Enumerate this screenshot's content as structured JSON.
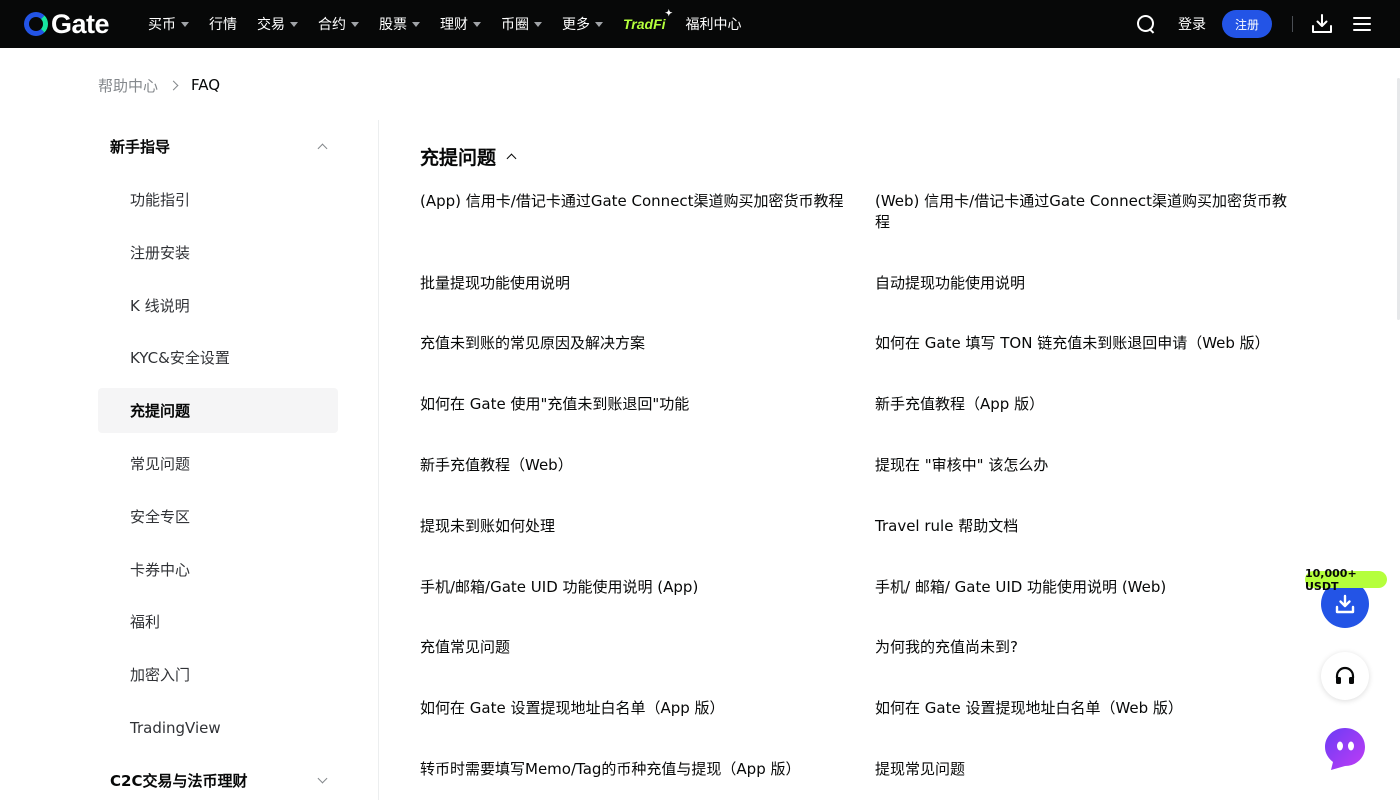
{
  "header": {
    "logo_text": "Gate",
    "nav": [
      {
        "label": "买币",
        "dropdown": true
      },
      {
        "label": "行情",
        "dropdown": false
      },
      {
        "label": "交易",
        "dropdown": true
      },
      {
        "label": "合约",
        "dropdown": true
      },
      {
        "label": "股票",
        "dropdown": true
      },
      {
        "label": "理财",
        "dropdown": true
      },
      {
        "label": "币圈",
        "dropdown": true
      },
      {
        "label": "更多",
        "dropdown": true
      }
    ],
    "tradfi_label": "TradFi",
    "welfare_label": "福利中心",
    "login_label": "登录",
    "signup_label": "注册",
    "search_icon": "search-icon",
    "download_icon": "download-icon",
    "menu_icon": "menu-icon"
  },
  "breadcrumb": {
    "home": "帮助中心",
    "current": "FAQ"
  },
  "sidebar": {
    "group_top": "新手指导",
    "items": [
      {
        "label": "功能指引",
        "active": false
      },
      {
        "label": "注册安装",
        "active": false
      },
      {
        "label": "K 线说明",
        "active": false
      },
      {
        "label": "KYC&安全设置",
        "active": false
      },
      {
        "label": "充提问题",
        "active": true
      },
      {
        "label": "常见问题",
        "active": false
      },
      {
        "label": "安全专区",
        "active": false
      },
      {
        "label": "卡券中心",
        "active": false
      },
      {
        "label": "福利",
        "active": false
      },
      {
        "label": "加密入门",
        "active": false
      },
      {
        "label": "TradingView",
        "active": false
      }
    ],
    "group_bottom": "C2C交易与法币理财"
  },
  "main": {
    "section_title": "充提问题",
    "faq_rows": [
      [
        "(App) 信用卡/借记卡通过Gate Connect渠道购买加密货币教程",
        "(Web) 信用卡/借记卡通过Gate Connect渠道购买加密货币教程"
      ],
      [
        "批量提现功能使用说明",
        "自动提现功能使用说明"
      ],
      [
        "充值未到账的常见原因及解决方案",
        "如何在 Gate 填写 TON 链充值未到账退回申请（Web 版）"
      ],
      [
        "如何在 Gate 使用\"充值未到账退回\"功能",
        "新手充值教程（App 版）"
      ],
      [
        "新手充值教程（Web）",
        "提现在 \"审核中\" 该怎么办"
      ],
      [
        "提现未到账如何处理",
        "Travel rule 帮助文档"
      ],
      [
        "手机/邮箱/Gate UID 功能使用说明 (App)",
        "手机/ 邮箱/ Gate UID 功能使用说明 (Web)"
      ],
      [
        "充值常见问题",
        "为何我的充值尚未到?"
      ],
      [
        "如何在 Gate 设置提现地址白名单（App 版）",
        "如何在 Gate 设置提现地址白名单（Web 版）"
      ],
      [
        "转币时需要填写Memo/Tag的币种充值与提现（App 版）",
        "提现常见问题"
      ]
    ]
  },
  "floating": {
    "badge": "10,000+ USDT",
    "download_icon": "download-icon",
    "support_icon": "headset-icon",
    "bot_icon": "chatbot-icon"
  },
  "colors": {
    "nav_bg": "#070808",
    "brand_blue": "#2354e6",
    "brand_green": "#17e6a1",
    "accent_lime": "#b5ff3c",
    "active_bg": "#f5f5f6"
  }
}
